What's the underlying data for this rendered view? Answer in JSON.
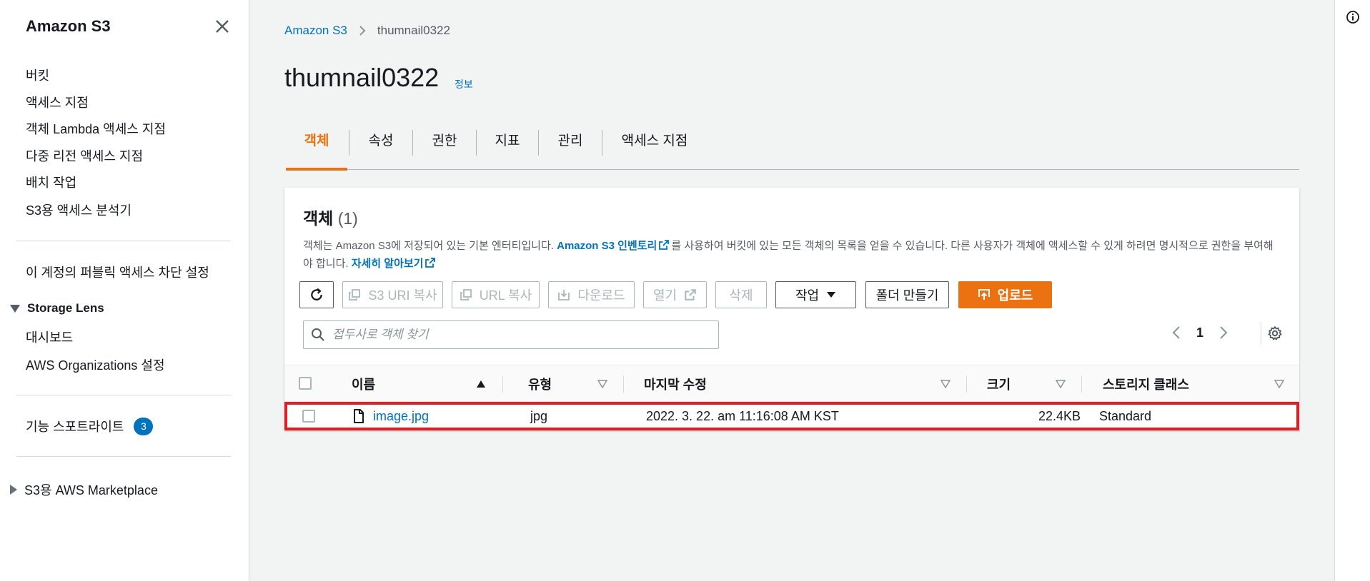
{
  "sidebar": {
    "title": "Amazon S3",
    "items": [
      "버킷",
      "액세스 지점",
      "객체 Lambda 액세스 지점",
      "다중 리전 액세스 지점",
      "배치 작업",
      "S3용 액세스 분석기"
    ],
    "block_public_access": "이 계정의 퍼블릭 액세스 차단 설정",
    "storage_lens": {
      "title": "Storage Lens",
      "items": [
        "대시보드",
        "AWS Organizations 설정"
      ]
    },
    "feature_spotlight": {
      "label": "기능 스포트라이트",
      "badge": "3"
    },
    "marketplace": "S3용 AWS Marketplace"
  },
  "breadcrumb": {
    "root": "Amazon S3",
    "current": "thumnail0322"
  },
  "page": {
    "title": "thumnail0322",
    "info_link": "정보"
  },
  "tabs": [
    "객체",
    "속성",
    "권한",
    "지표",
    "관리",
    "액세스 지점"
  ],
  "panel": {
    "title": "객체",
    "count": "(1)",
    "desc_part1": "객체는 Amazon S3에 저장되어 있는 기본 엔터티입니다. ",
    "desc_link1": "Amazon S3 인벤토리",
    "desc_part2": "를 사용하여 버킷에 있는 모든 객체의 목록을 얻을 수 있습니다. 다른 사용자가 객체에 액세스할 수 있게 하려면 명시적으로 권한을 부여해야 합니다. ",
    "desc_link2": "자세히 알아보기"
  },
  "toolbar": {
    "copy_s3_uri": "S3 URI 복사",
    "copy_url": "URL 복사",
    "download": "다운로드",
    "open": "열기",
    "delete": "삭제",
    "actions": "작업",
    "create_folder": "폴더 만들기",
    "upload": "업로드"
  },
  "search": {
    "placeholder": "접두사로 객체 찾기",
    "value": ""
  },
  "pagination": {
    "current_page": "1"
  },
  "table": {
    "columns": [
      "이름",
      "유형",
      "마지막 수정",
      "크기",
      "스토리지 클래스"
    ],
    "rows": [
      {
        "name": "image.jpg",
        "type": "jpg",
        "last_modified": "2022. 3. 22. am 11:16:08 AM KST",
        "size": "22.4KB",
        "storage_class": "Standard"
      }
    ]
  },
  "icons": {
    "close": "close-icon",
    "refresh": "refresh-icon",
    "copy": "copy-icon",
    "download": "download-icon",
    "external": "external-link-icon",
    "caret": "caret-down-icon",
    "upload": "upload-icon",
    "search": "search-icon",
    "settings": "gear-icon",
    "file": "file-icon",
    "info": "info-icon"
  },
  "colors": {
    "accent": "#ec7211",
    "link": "#0073bb",
    "highlight": "#df1f26",
    "badge": "#0073bb"
  }
}
